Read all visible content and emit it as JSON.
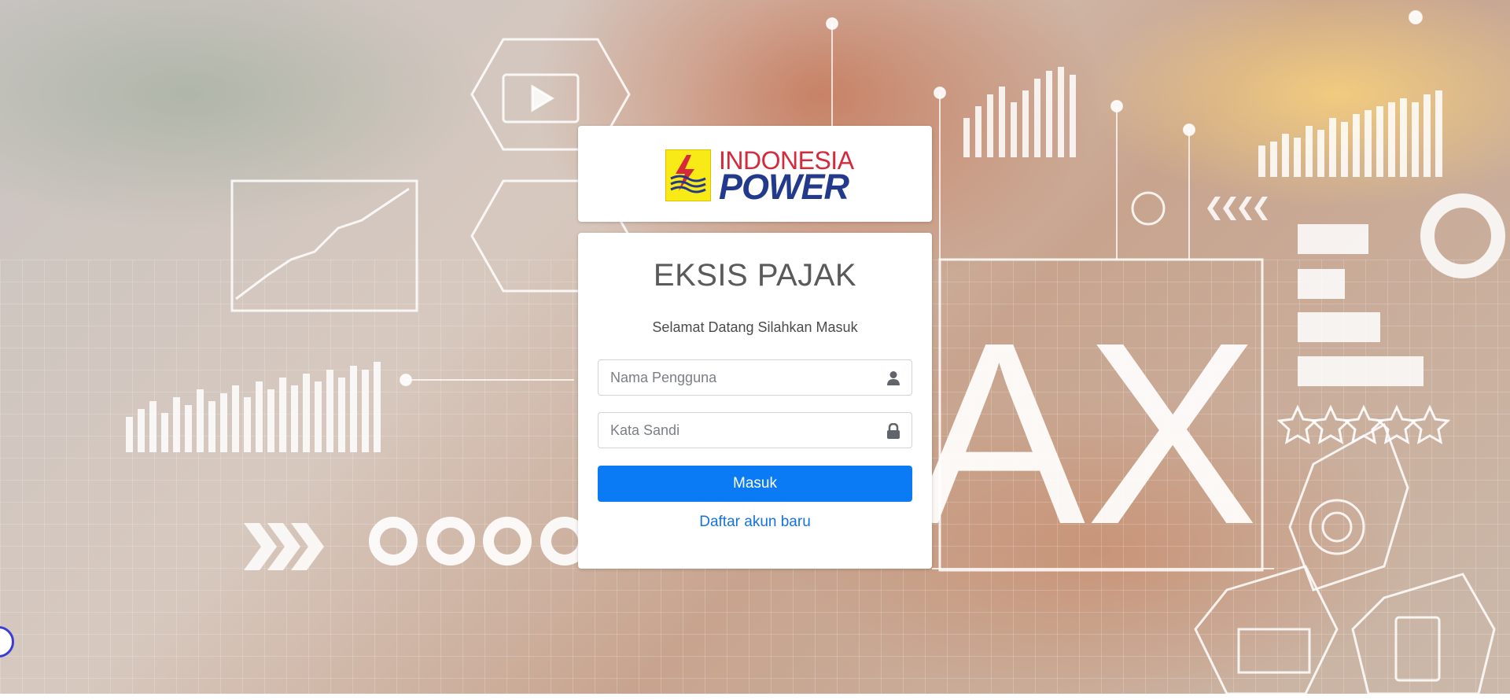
{
  "logo": {
    "line1": "INDONESIA",
    "line2": "POWER"
  },
  "login": {
    "title": "EKSIS PAJAK",
    "subtitle": "Selamat Datang Silahkan Masuk",
    "username_placeholder": "Nama Pengguna",
    "password_placeholder": "Kata Sandi",
    "submit_label": "Masuk",
    "register_label": "Daftar akun baru"
  },
  "icons": {
    "username": "user-icon",
    "password": "lock-icon"
  },
  "colors": {
    "primary_button": "#0a7bf5",
    "link": "#1672e0",
    "logo_red": "#d62a3c",
    "logo_blue": "#233a8c",
    "logo_yellow": "#f8ea17"
  }
}
